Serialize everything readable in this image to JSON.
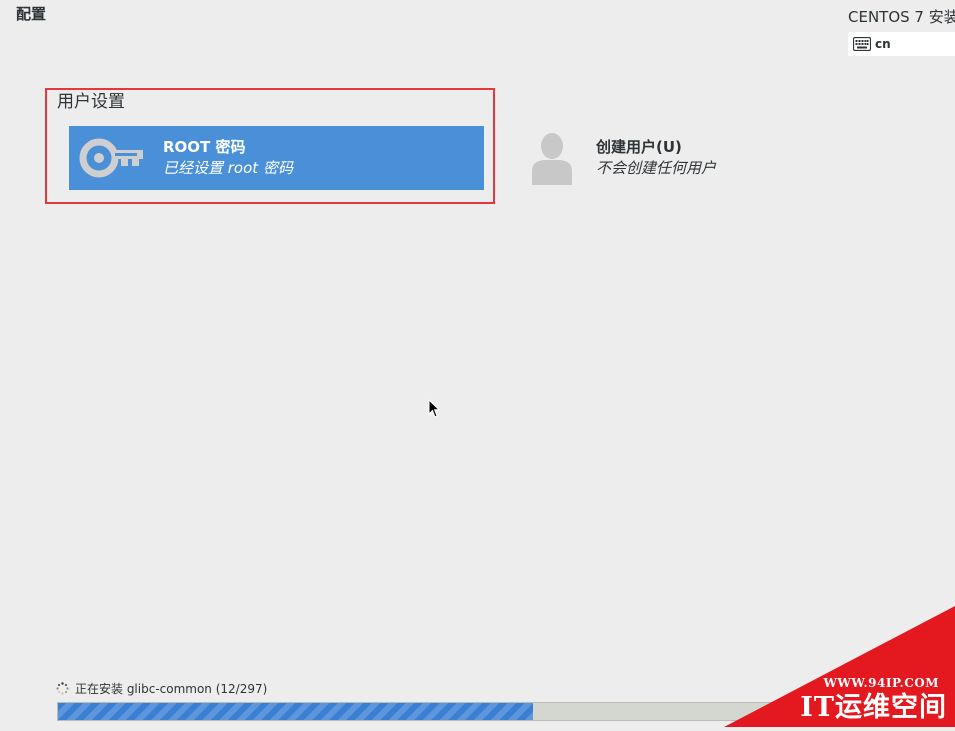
{
  "header": {
    "page_title": "配置",
    "product_title": "CENTOS 7 安装",
    "keyboard_layout": "cn"
  },
  "user_settings": {
    "section_title": "用户设置",
    "root_password": {
      "name": "ROOT 密码",
      "status": "已经设置 root 密码",
      "icon": "key-icon",
      "selected": true
    },
    "create_user": {
      "name": "创建用户(U)",
      "status": "不会创建任何用户",
      "icon": "user-icon"
    }
  },
  "install_progress": {
    "status_text": "正在安装 glibc-common (12/297)",
    "fraction": 0.53
  },
  "watermark": {
    "url": "WWW.94IP.COM",
    "name": "IT运维空间"
  },
  "colors": {
    "background": "#ededed",
    "selected_spoke": "#4a90d9",
    "highlight_frame": "#e6373f",
    "progress_fill": "#3b7fd4",
    "watermark_red": "#e4191f"
  }
}
